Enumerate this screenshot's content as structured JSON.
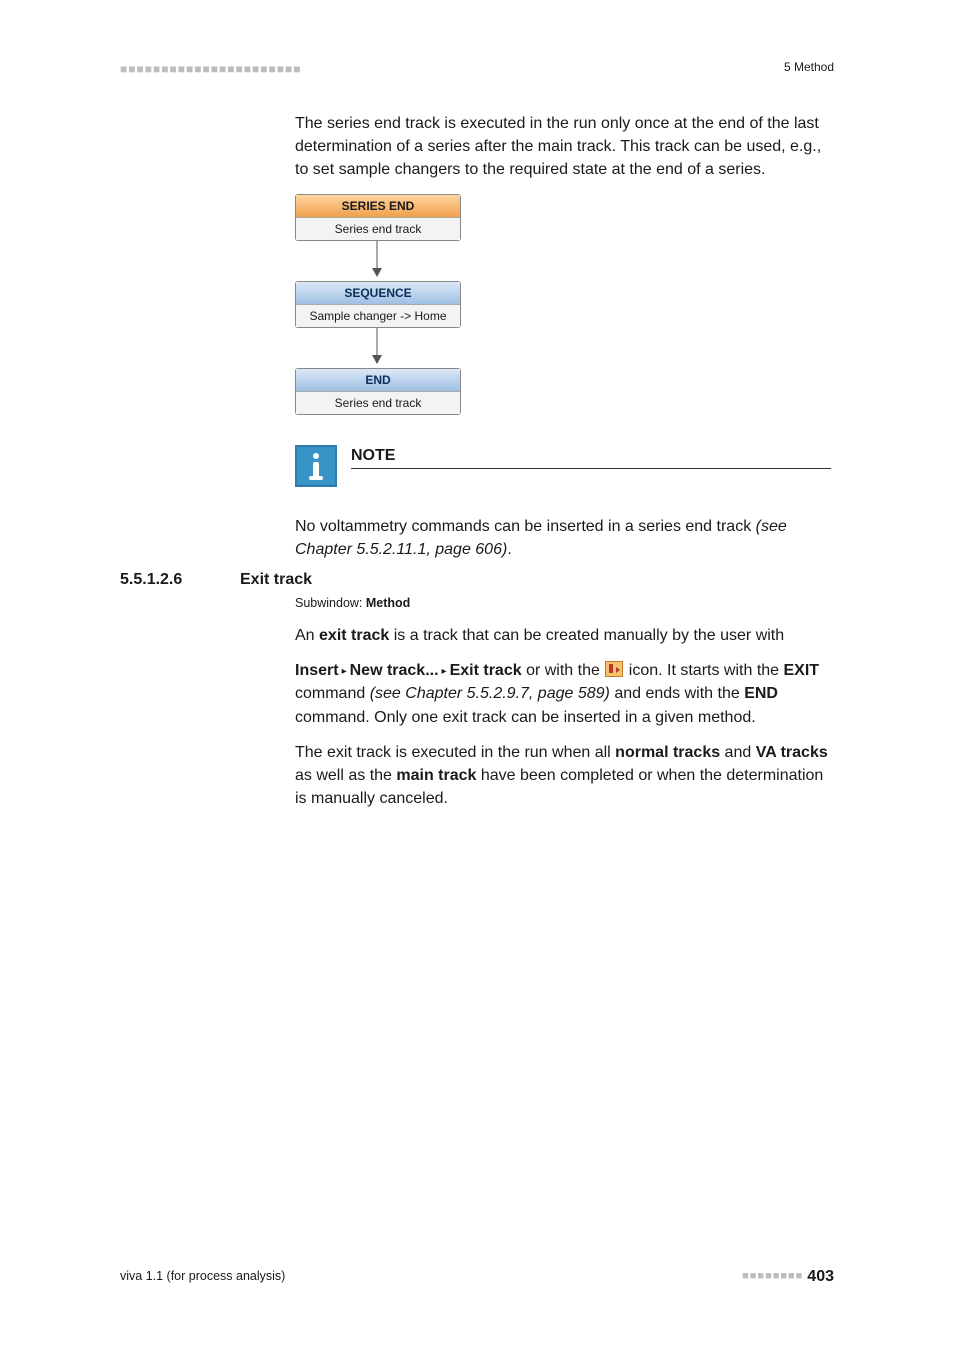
{
  "header": {
    "dashes": "■■■■■■■■■■■■■■■■■■■■■■",
    "right": "5 Method"
  },
  "intro": "The series end track is executed in the run only once at the end of the last determination of a series after the main track. This track can be used, e.g., to set sample changers to the required state at the end of a series.",
  "flow": {
    "b1_head": "SERIES END",
    "b1_sub": "Series end track",
    "b2_head": "SEQUENCE",
    "b2_sub": "Sample changer -> Home",
    "b3_head": "END",
    "b3_sub": "Series end track"
  },
  "note": {
    "title": "NOTE",
    "body_pre": "No voltammetry commands can be inserted in a series end track ",
    "body_it": "(see Chapter 5.5.2.11.1, page 606)",
    "body_post": "."
  },
  "section": {
    "num": "5.5.1.2.6",
    "title": "Exit track",
    "subwin_label": "Subwindow: ",
    "subwin_value": "Method",
    "p1_a": "An ",
    "p1_b": "exit track",
    "p1_c": " is a track that can be created manually by the user with",
    "p2_a": "Insert",
    "p2_b": "New track...",
    "p2_c": "Exit track",
    "p2_d": " or with the ",
    "p2_e": " icon. It starts with the ",
    "p2_f": "EXIT",
    "p2_g": " command ",
    "p2_h": "(see Chapter 5.5.2.9.7, page 589)",
    "p2_i": " and ends with the ",
    "p2_j": "END",
    "p2_k": " command. Only one exit track can be inserted in a given method.",
    "p3_a": "The exit track is executed in the run when all ",
    "p3_b": "normal tracks",
    "p3_c": " and ",
    "p3_d": "VA tracks",
    "p3_e": " as well as the ",
    "p3_f": "main track",
    "p3_g": " have been completed or when the determination is manually canceled.",
    "tri": "▸"
  },
  "footer": {
    "left": "viva 1.1 (for process analysis)",
    "dashes": "■■■■■■■■",
    "page": "403"
  }
}
